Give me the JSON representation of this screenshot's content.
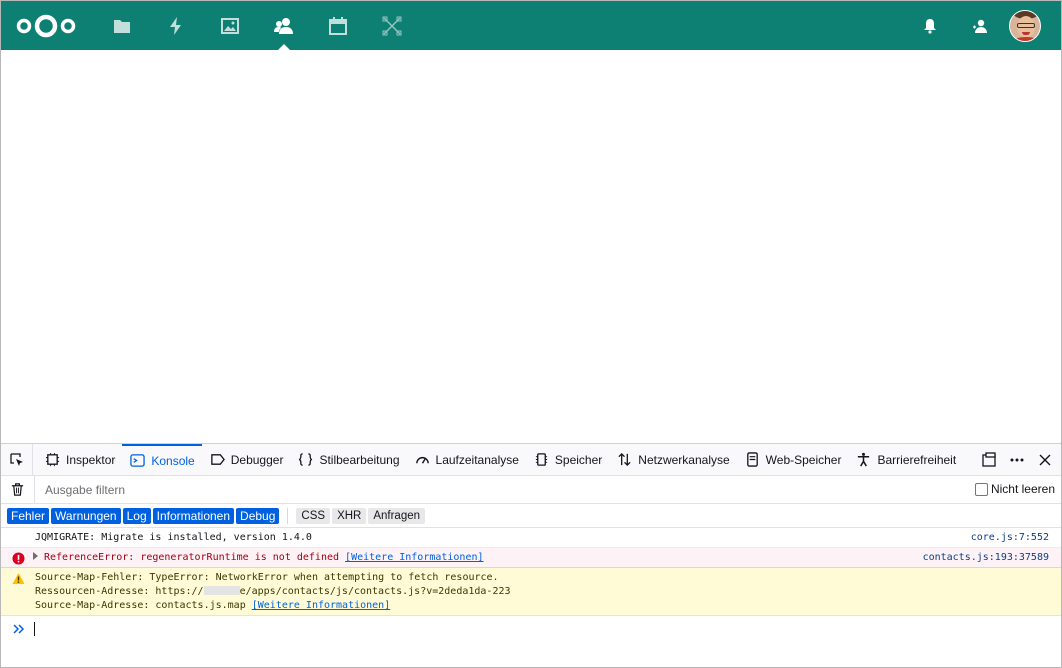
{
  "colors": {
    "header_bg": "#0d7f73",
    "devtools_accent": "#0061e0",
    "error_bg": "#fdf2f5",
    "warning_bg": "#fffbd6"
  },
  "nextcloud": {
    "nav": [
      {
        "name": "files-icon"
      },
      {
        "name": "activity-icon"
      },
      {
        "name": "photos-icon"
      },
      {
        "name": "contacts-icon",
        "active": true
      },
      {
        "name": "calendar-icon"
      },
      {
        "name": "deck-icon"
      }
    ],
    "right": [
      "notifications-icon",
      "contacts-menu-icon",
      "avatar"
    ]
  },
  "devtools": {
    "tabs": [
      {
        "label": "Inspektor",
        "icon": "inspector-icon"
      },
      {
        "label": "Konsole",
        "icon": "console-icon",
        "selected": true
      },
      {
        "label": "Debugger",
        "icon": "debugger-icon"
      },
      {
        "label": "Stilbearbeitung",
        "icon": "style-editor-icon"
      },
      {
        "label": "Laufzeitanalyse",
        "icon": "performance-icon"
      },
      {
        "label": "Speicher",
        "icon": "memory-icon"
      },
      {
        "label": "Netzwerkanalyse",
        "icon": "network-icon"
      },
      {
        "label": "Web-Speicher",
        "icon": "storage-icon"
      },
      {
        "label": "Barrierefreiheit",
        "icon": "accessibility-icon"
      }
    ],
    "filter": {
      "placeholder": "Ausgabe filtern"
    },
    "persist_label": "Nicht leeren",
    "levels": [
      "Fehler",
      "Warnungen",
      "Log",
      "Informationen",
      "Debug"
    ],
    "request_filters": [
      "CSS",
      "XHR",
      "Anfragen"
    ],
    "messages": [
      {
        "type": "log",
        "text": "JQMIGRATE: Migrate is installed, version 1.4.0",
        "location": "core.js:7:552"
      },
      {
        "type": "error",
        "text": "ReferenceError: regeneratorRuntime is not defined",
        "more": "[Weitere Informationen]",
        "location": "contacts.js:193:37589"
      },
      {
        "type": "warning",
        "line1": "Source-Map-Fehler: TypeError: NetworkError when attempting to fetch resource.",
        "line2_prefix": "Ressourcen-Adresse: https://",
        "line2_suffix": "e/apps/contacts/js/contacts.js?v=2deda1da-223",
        "line3": "Source-Map-Adresse: contacts.js.map",
        "more": "[Weitere Informationen]"
      }
    ]
  }
}
